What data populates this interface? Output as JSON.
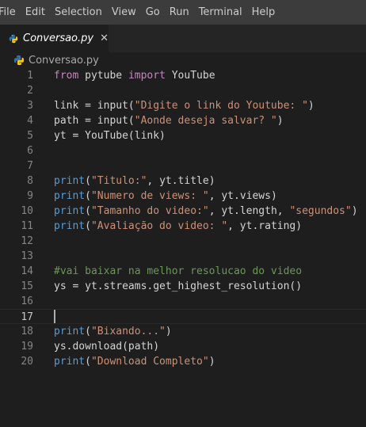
{
  "menu": [
    "File",
    "Edit",
    "Selection",
    "View",
    "Go",
    "Run",
    "Terminal",
    "Help"
  ],
  "tab": {
    "title": "Conversao.py",
    "close_symbol": "✕",
    "icon": "python-icon"
  },
  "breadcrumb": {
    "file": "Conversao.py",
    "icon": "python-icon"
  },
  "colors": {
    "background": "#1e1e1e",
    "menubar": "#3c3c3c",
    "keyword": "#c586c0",
    "builtin": "#569cd6",
    "string": "#ce9178",
    "comment": "#6a9955",
    "text": "#d4d4d4",
    "line_number": "#858585"
  },
  "editor": {
    "active_line": 17,
    "lines": [
      {
        "n": "1",
        "tokens": [
          [
            "kw",
            "from"
          ],
          [
            "tx",
            " pytube "
          ],
          [
            "kw",
            "import"
          ],
          [
            "tx",
            " YouTube"
          ]
        ]
      },
      {
        "n": "2",
        "tokens": []
      },
      {
        "n": "3",
        "tokens": [
          [
            "tx",
            "link = input("
          ],
          [
            "str",
            "\"Digite o link do Youtube: \""
          ],
          [
            "tx",
            ")"
          ]
        ]
      },
      {
        "n": "4",
        "tokens": [
          [
            "tx",
            "path = input("
          ],
          [
            "str",
            "\"Aonde deseja salvar? \""
          ],
          [
            "tx",
            ")"
          ]
        ]
      },
      {
        "n": "5",
        "tokens": [
          [
            "tx",
            "yt = YouTube(link)"
          ]
        ]
      },
      {
        "n": "6",
        "tokens": []
      },
      {
        "n": "7",
        "tokens": []
      },
      {
        "n": "8",
        "tokens": [
          [
            "fn",
            "print"
          ],
          [
            "tx",
            "("
          ],
          [
            "str",
            "\"Titulo:\""
          ],
          [
            "tx",
            ", yt.title)"
          ]
        ]
      },
      {
        "n": "9",
        "tokens": [
          [
            "fn",
            "print"
          ],
          [
            "tx",
            "("
          ],
          [
            "str",
            "\"Numero de views: \""
          ],
          [
            "tx",
            ", yt.views)"
          ]
        ]
      },
      {
        "n": "10",
        "tokens": [
          [
            "fn",
            "print"
          ],
          [
            "tx",
            "("
          ],
          [
            "str",
            "\"Tamanho do video:\""
          ],
          [
            "tx",
            ", yt.length, "
          ],
          [
            "str",
            "\"segundos\""
          ],
          [
            "tx",
            ")"
          ]
        ]
      },
      {
        "n": "11",
        "tokens": [
          [
            "fn",
            "print"
          ],
          [
            "tx",
            "("
          ],
          [
            "str",
            "\"Avaliação do video: \""
          ],
          [
            "tx",
            ", yt.rating)"
          ]
        ]
      },
      {
        "n": "12",
        "tokens": []
      },
      {
        "n": "13",
        "tokens": []
      },
      {
        "n": "14",
        "tokens": [
          [
            "cm",
            "#vai baixar na melhor resolucao do video"
          ]
        ]
      },
      {
        "n": "15",
        "tokens": [
          [
            "tx",
            "ys = yt.streams.get_highest_resolution()"
          ]
        ]
      },
      {
        "n": "16",
        "tokens": []
      },
      {
        "n": "17",
        "tokens": []
      },
      {
        "n": "18",
        "tokens": [
          [
            "fn",
            "print"
          ],
          [
            "tx",
            "("
          ],
          [
            "str",
            "\"Bixando...\""
          ],
          [
            "tx",
            ")"
          ]
        ]
      },
      {
        "n": "19",
        "tokens": [
          [
            "tx",
            "ys.download(path)"
          ]
        ]
      },
      {
        "n": "20",
        "tokens": [
          [
            "fn",
            "print"
          ],
          [
            "tx",
            "("
          ],
          [
            "str",
            "\"Download Completo\""
          ],
          [
            "tx",
            ")"
          ]
        ]
      }
    ]
  }
}
